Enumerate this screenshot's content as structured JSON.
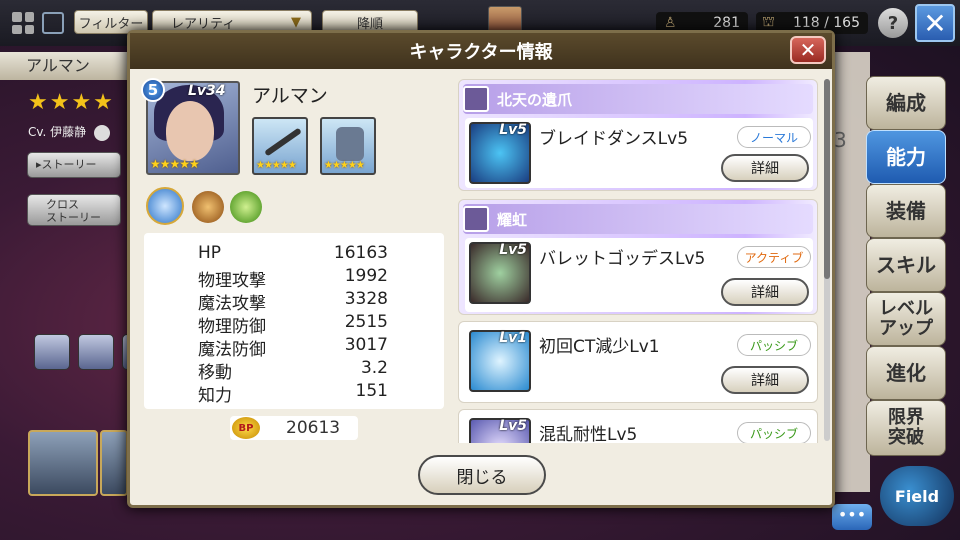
{
  "topbar": {
    "filter_label": "フィルター",
    "rarity_label": "レアリティ",
    "sort_label": "降順",
    "resource1": "281",
    "resource2": "118 / 165",
    "help": "?"
  },
  "background": {
    "char_name": "アルマン",
    "stars": "★★★★",
    "cv": "Cv. 伊藤静",
    "story_button": "ストーリー",
    "cross_story_button": "クロス\nストーリー",
    "side_number": "3"
  },
  "side_nav": [
    "編成",
    "能力",
    "装備",
    "スキル",
    "レベル\nアップ",
    "進化",
    "限界\n突破"
  ],
  "side_nav_active": "能力",
  "field_label": "Field",
  "chat_label": "•••",
  "modal": {
    "title": "キャラクター情報",
    "close_x": "✕",
    "character": {
      "name": "アルマン",
      "level": "Lv34",
      "rank": "5",
      "stars": "★★★★★",
      "equip_stars": "★★★★★"
    },
    "stats": [
      {
        "label": "HP",
        "value": "16163"
      },
      {
        "label": "物理攻撃",
        "value": "1992"
      },
      {
        "label": "魔法攻撃",
        "value": "3328"
      },
      {
        "label": "物理防御",
        "value": "2515"
      },
      {
        "label": "魔法防御",
        "value": "3017"
      },
      {
        "label": "移動",
        "value": "3.2"
      },
      {
        "label": "知力",
        "value": "151"
      }
    ],
    "bp": {
      "icon": "BP",
      "value": "20613"
    },
    "skills": [
      {
        "group": "北天の遺爪",
        "name": "ブレイドダンスLv5",
        "level": "Lv5",
        "type": "ノーマル",
        "detail": "詳細"
      },
      {
        "group": "耀虹",
        "name": "バレットゴッデスLv5",
        "level": "Lv5",
        "type": "アクティブ",
        "detail": "詳細"
      },
      {
        "name": "初回CT減少Lv1",
        "level": "Lv1",
        "type": "パッシブ",
        "detail": "詳細"
      },
      {
        "name": "混乱耐性Lv5",
        "level": "Lv5",
        "type": "パッシブ"
      }
    ],
    "close_button": "閉じる"
  }
}
